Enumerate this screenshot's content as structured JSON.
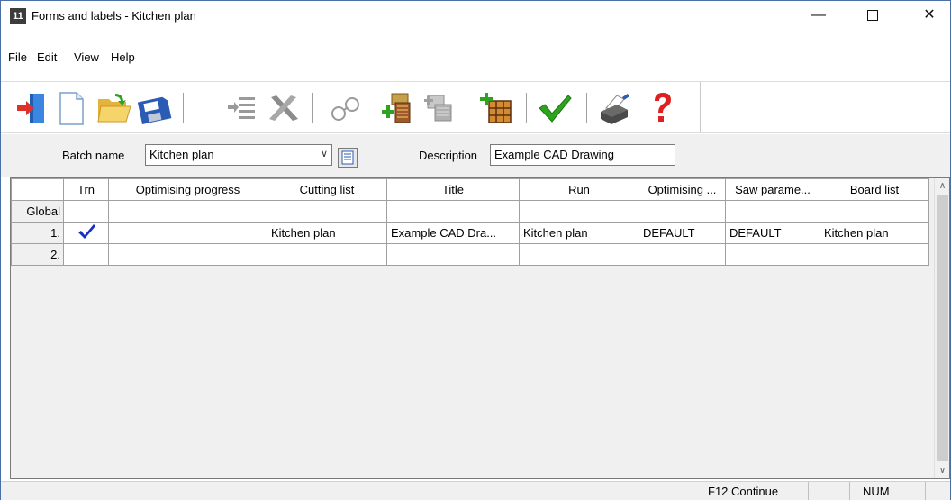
{
  "window": {
    "title": "Forms and labels - Kitchen plan",
    "app_icon_text": "11"
  },
  "menu": [
    "File",
    "Edit",
    "View",
    "Help"
  ],
  "toolbar": {
    "icons": [
      "exit-door-icon",
      "new-document-icon",
      "open-folder-icon",
      "save-disk-icon",
      "list-indent-icon",
      "delete-x-icon",
      "glasses-icon",
      "add-batch-icon",
      "edit-batch-icon",
      "add-table-icon",
      "checkmark-icon",
      "printer-icon",
      "help-icon"
    ],
    "colors": {
      "check": "#2da41e",
      "help": "#e02020",
      "folder": "#f2c94c",
      "disk": "#2a5bb5"
    }
  },
  "form": {
    "batch_label": "Batch name",
    "batch_value": "Kitchen plan",
    "description_label": "Description",
    "description_value": "Example CAD Drawing"
  },
  "grid": {
    "headers": [
      "",
      "Trn",
      "Optimising progress",
      "Cutting list",
      "Title",
      "Run",
      "Optimising ...",
      "Saw parame...",
      "Board list"
    ],
    "rows": [
      {
        "label": "Global",
        "checked": false,
        "cells": [
          "",
          "",
          "",
          "",
          "",
          "",
          ""
        ]
      },
      {
        "label": "1.",
        "checked": true,
        "cells": [
          "",
          "Kitchen plan",
          "Example CAD Dra...",
          "Kitchen plan",
          "DEFAULT",
          "DEFAULT",
          "Kitchen plan"
        ]
      },
      {
        "label": "2.",
        "checked": false,
        "cells": [
          "",
          "",
          "",
          "",
          "",
          "",
          ""
        ]
      }
    ]
  },
  "status": {
    "continue": "F12 Continue",
    "num": "NUM"
  }
}
